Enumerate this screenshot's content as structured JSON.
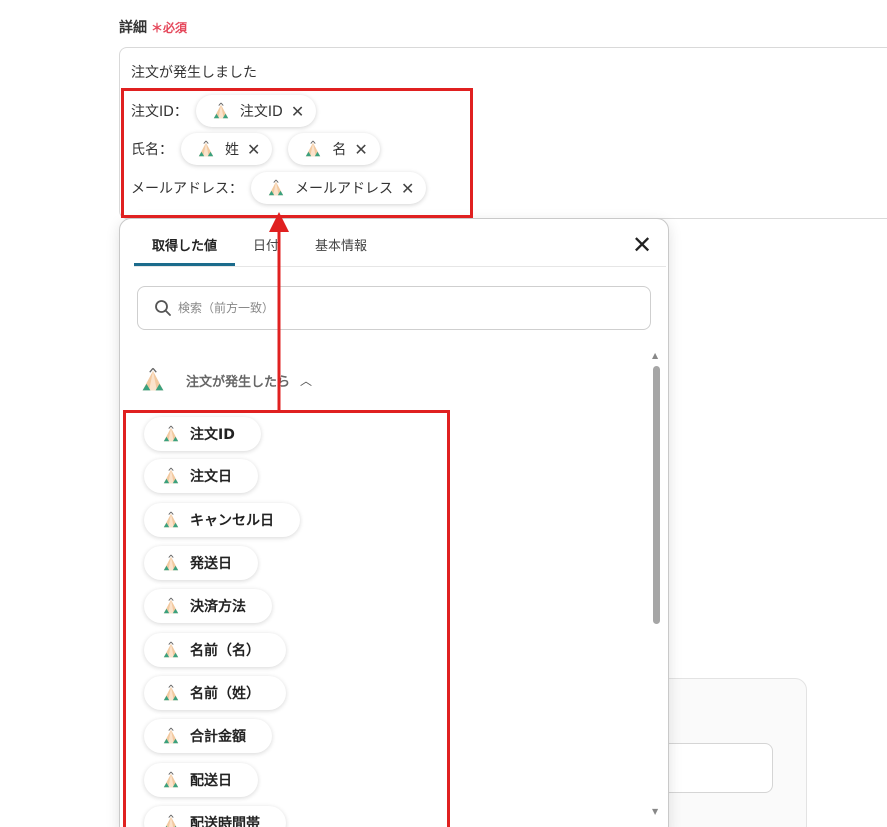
{
  "field": {
    "label": "詳細",
    "required": "＊必須"
  },
  "template": {
    "first_line": "注文が発生しました",
    "rows": [
      {
        "label": "注文ID：",
        "chips": [
          "注文ID"
        ]
      },
      {
        "label": "氏名：",
        "chips": [
          "姓",
          "名"
        ]
      },
      {
        "label": "メールアドレス：",
        "chips": [
          "メールアドレス"
        ]
      }
    ],
    "chip_remove_glyph": "✕"
  },
  "popup": {
    "tabs": [
      "取得した値",
      "日付",
      "基本情報"
    ],
    "active_tab": 0,
    "close_glyph": "✕",
    "search": {
      "placeholder": "検索（前方一致）",
      "value": ""
    },
    "group": {
      "label": "注文が発生したら",
      "expanded": true,
      "chevron": "︿"
    },
    "items": [
      "注文ID",
      "注文日",
      "キャンセル日",
      "発送日",
      "決済方法",
      "名前（名）",
      "名前（姓）",
      "合計金額",
      "配送日",
      "配送時間帯"
    ],
    "scroll_up_glyph": "▲",
    "scroll_down_glyph": "▼"
  },
  "icons": {
    "chip_icon": "tent-icon",
    "search_icon": "search-icon",
    "close_icon": "close-icon",
    "chevron_icon": "chevron-up-icon"
  },
  "colors": {
    "required": "#e5485b",
    "highlight": "#e02020",
    "tab_active": "#1b6b8c",
    "tent_green": "#3aa17e",
    "tent_beige": "#f2c9a0"
  }
}
